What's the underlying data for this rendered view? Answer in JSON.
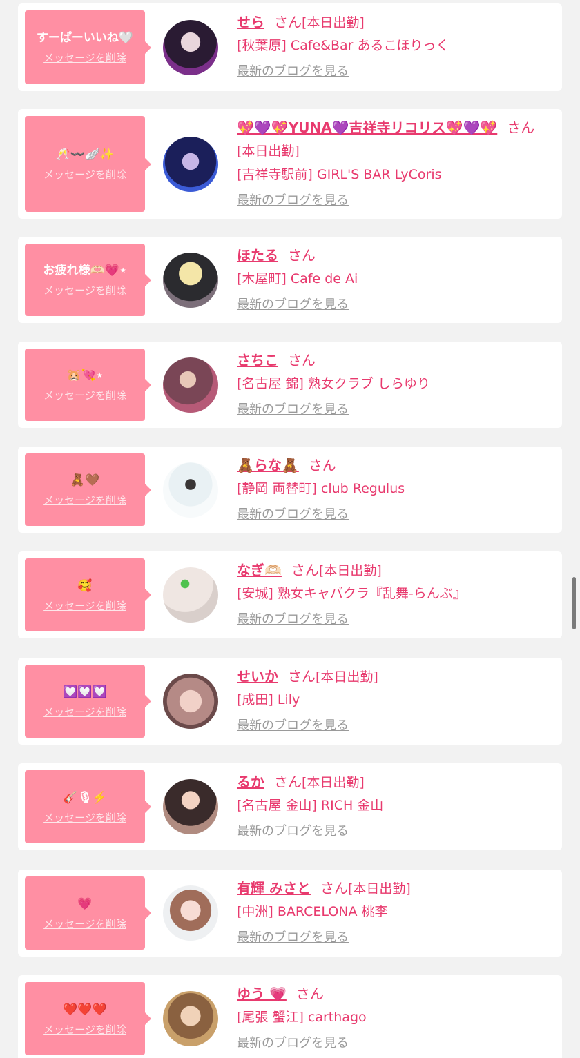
{
  "delete_label": "メッセージを削除",
  "blog_label": "最新のブログを見る",
  "san_label": "さん",
  "colors": {
    "bubble": "#ff8fa3",
    "accent": "#e83a6e",
    "link_gray": "#9a9a9a",
    "bg": "#f2f2f2"
  },
  "cards": [
    {
      "message": "すーぱーいいね🤍",
      "name": "せら",
      "status": "[本日出勤]",
      "store_line1": "[秋葉原] Cafe&Bar あるこほりっく",
      "store_line2": ""
    },
    {
      "message": "🥂〰️🪽✨",
      "name": "💖💜💖YUNA💜吉祥寺リコリス💖💜💖",
      "status": "",
      "store_line1": "[本日出勤]",
      "store_line2": "[吉祥寺駅前] GIRL'S BAR LyCoris"
    },
    {
      "message": "お疲れ様🫶🏻💗⋆",
      "name": "ほたる",
      "status": "",
      "store_line1": "[木屋町] Cafe de Ai",
      "store_line2": ""
    },
    {
      "message": "🐹💘⋆",
      "name": "さちこ",
      "status": "",
      "store_line1": "[名古屋 錦] 熟女クラブ しらゆり",
      "store_line2": ""
    },
    {
      "message": "🧸🤎",
      "name": "🧸らな🧸",
      "status": "",
      "store_line1": "[静岡 両替町] club Regulus",
      "store_line2": ""
    },
    {
      "message": "🥰",
      "name": "なぎ🫶🏻",
      "status": "[本日出勤]",
      "store_line1": "[安城] 熟女キャバクラ『乱舞-らんぶ』",
      "store_line2": ""
    },
    {
      "message": "💟💟💟",
      "name": "せいか",
      "status": "[本日出勤]",
      "store_line1": "[成田] Lily",
      "store_line2": ""
    },
    {
      "message": "🎸🎙⚡️",
      "name": "るか",
      "status": "[本日出勤]",
      "store_line1": "[名古屋 金山] RICH 金山",
      "store_line2": ""
    },
    {
      "message": "💗",
      "name": "有輝 みさと",
      "status": "[本日出勤]",
      "store_line1": "[中洲] BARCELONA 桃李",
      "store_line2": ""
    },
    {
      "message": "❤️❤️❤️",
      "name": "ゆう 💗",
      "status": "",
      "store_line1": "[尾張 蟹江] carthago",
      "store_line2": ""
    }
  ]
}
